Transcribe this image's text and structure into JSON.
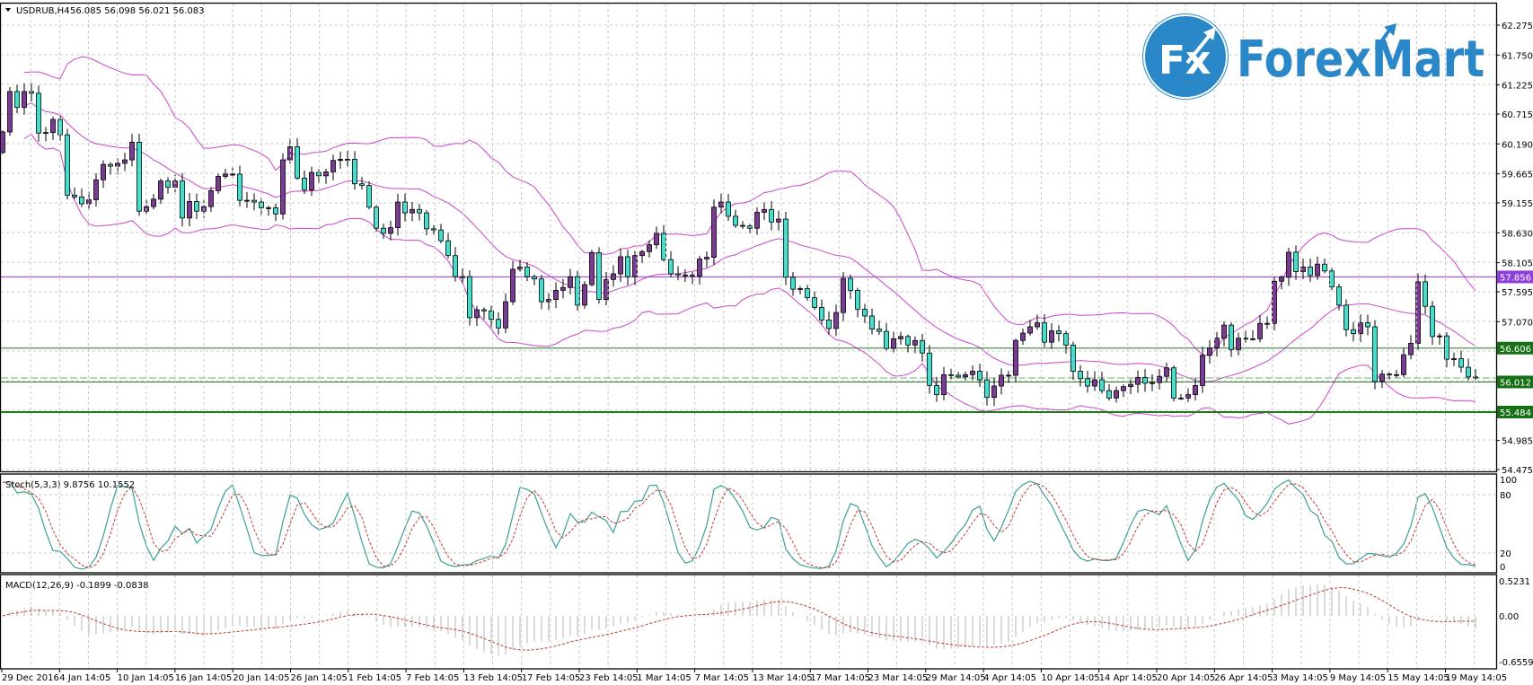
{
  "header": {
    "symbol_label": "USDRUB,H4",
    "ohlc": "56.085 56.098 56.021 56.083",
    "menu_icon": "triangle-down-icon"
  },
  "logo": {
    "badge": "Fx",
    "text": "ForexMart",
    "color": "#2b88c8"
  },
  "price_axis": {
    "ticks": [
      "62.275",
      "61.750",
      "61.225",
      "60.715",
      "60.190",
      "59.665",
      "59.155",
      "58.630",
      "58.105",
      "57.595",
      "57.070",
      "54.985",
      "54.475"
    ]
  },
  "levels": [
    {
      "value": 57.856,
      "label": "57.856",
      "color": "#9933cc",
      "label_bg": "#8e3fd8"
    },
    {
      "value": 56.606,
      "label": "56.606",
      "color": "#1f7a1f",
      "label_bg": "#167016"
    },
    {
      "value": 56.012,
      "label": "56.012",
      "color": "#1f7a1f",
      "label_bg": "#167016"
    },
    {
      "value": 55.484,
      "label": "55.484",
      "color": "#1f7a1f",
      "label_bg": "#167016"
    }
  ],
  "bid_line": 56.083,
  "stoch": {
    "label": "Stoch(5,3,3) 9.8756 10.1552",
    "ticks": [
      "100",
      "80",
      "20",
      "0"
    ]
  },
  "macd": {
    "label": "MACD(12,26,9) -0.1899 -0.0838",
    "ticks": [
      "0.5231",
      "0.00",
      "-0.6559"
    ]
  },
  "time_axis": {
    "labels": [
      "29 Dec 2016",
      "4 Jan 14:05",
      "10 Jan 14:05",
      "16 Jan 14:05",
      "20 Jan 14:05",
      "26 Jan 14:05",
      "1 Feb 14:05",
      "7 Feb 14:05",
      "13 Feb 14:05",
      "17 Feb 14:05",
      "23 Feb 14:05",
      "1 Mar 14:05",
      "7 Mar 14:05",
      "13 Mar 14:05",
      "17 Mar 14:05",
      "23 Mar 14:05",
      "29 Mar 14:05",
      "4 Apr 14:05",
      "10 Apr 14:05",
      "14 Apr 14:05",
      "20 Apr 14:05",
      "26 Apr 14:05",
      "3 May 14:05",
      "9 May 14:05",
      "15 May 14:05",
      "19 May 14:05"
    ]
  },
  "colors": {
    "bull": "#7b3a96",
    "bear": "#40e0d0",
    "bands": "#cc44cc",
    "stoch_main": "#3a9f96",
    "stoch_signal": "#c0392b",
    "macd_hist": "#b4b4b4",
    "macd_signal": "#c0392b"
  },
  "chart_data": {
    "type": "candlestick",
    "symbol": "USDRUB",
    "timeframe": "H4",
    "ylim": [
      54.475,
      62.275
    ],
    "first_open": 60.04,
    "closes": [
      60.4,
      61.11,
      60.83,
      61.11,
      61.08,
      60.38,
      60.39,
      60.62,
      60.35,
      59.29,
      59.26,
      59.14,
      59.21,
      59.56,
      59.83,
      59.8,
      59.85,
      59.91,
      60.22,
      59.01,
      59.09,
      59.22,
      59.54,
      59.43,
      59.54,
      58.89,
      59.18,
      59.01,
      59.09,
      59.37,
      59.62,
      59.66,
      59.66,
      59.2,
      59.2,
      59.17,
      59.07,
      59.07,
      58.96,
      59.91,
      60.14,
      59.59,
      59.38,
      59.69,
      59.63,
      59.7,
      59.9,
      59.92,
      59.92,
      59.49,
      59.46,
      59.08,
      58.71,
      58.62,
      58.72,
      59.17,
      58.98,
      59.04,
      58.98,
      58.7,
      58.68,
      58.49,
      58.23,
      57.86,
      57.86,
      57.14,
      57.28,
      57.26,
      57.11,
      56.96,
      57.42,
      57.99,
      58.03,
      57.86,
      57.82,
      57.42,
      57.46,
      57.62,
      57.67,
      57.86,
      57.36,
      57.72,
      58.28,
      57.46,
      57.81,
      57.91,
      58.21,
      57.86,
      58.23,
      58.3,
      58.42,
      58.62,
      58.16,
      57.91,
      57.89,
      57.89,
      57.87,
      58.17,
      58.2,
      59.08,
      59.17,
      58.92,
      58.76,
      58.75,
      58.71,
      58.99,
      59.04,
      58.82,
      58.87,
      57.85,
      57.64,
      57.65,
      57.49,
      57.32,
      57.1,
      56.95,
      57.23,
      57.83,
      57.62,
      57.29,
      57.17,
      56.94,
      56.9,
      56.6,
      56.77,
      56.81,
      56.66,
      56.74,
      56.52,
      55.95,
      55.79,
      56.14,
      56.13,
      56.1,
      56.14,
      56.2,
      56.05,
      55.74,
      55.94,
      56.13,
      56.13,
      56.74,
      56.87,
      56.98,
      57.05,
      56.71,
      56.91,
      56.86,
      56.66,
      56.2,
      56.07,
      55.94,
      56.05,
      55.86,
      55.73,
      55.86,
      55.93,
      55.97,
      56.09,
      55.99,
      56.0,
      56.11,
      56.26,
      55.73,
      55.73,
      55.79,
      55.95,
      56.48,
      56.61,
      56.78,
      57.01,
      56.58,
      56.78,
      56.77,
      56.77,
      57.04,
      57.04,
      57.78,
      57.85,
      58.29,
      57.95,
      58.03,
      57.88,
      58.08,
      57.96,
      57.68,
      57.36,
      56.93,
      56.86,
      57.05,
      56.98,
      56.02,
      56.15,
      56.14,
      56.14,
      56.49,
      56.69,
      57.77,
      57.34,
      56.81,
      56.82,
      56.41,
      56.42,
      56.27,
      56.1,
      56.083
    ],
    "indicators": [
      "Bollinger Bands(20,2)",
      "Stoch(5,3,3)",
      "MACD(12,26,9)"
    ]
  }
}
